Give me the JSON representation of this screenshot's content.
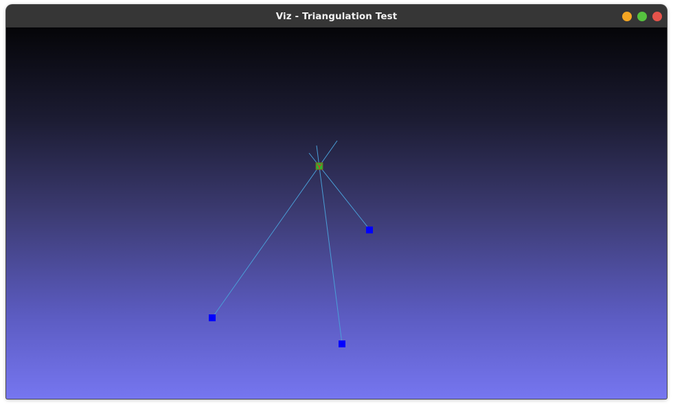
{
  "window": {
    "title": "Viz - Triangulation Test",
    "controls": [
      {
        "name": "minimize-button",
        "color": "#f5a623"
      },
      {
        "name": "maximize-button",
        "color": "#56c13f"
      },
      {
        "name": "close-button",
        "color": "#e5534b"
      }
    ]
  },
  "scene": {
    "colors": {
      "ray": "#4a9fd8",
      "camera_point": "#0000ff",
      "triangulated_fill": "#2fb52f",
      "triangulated_mark": "#e0302a",
      "background_top": "#050508",
      "background_bottom": "#7676f0"
    }
  }
}
